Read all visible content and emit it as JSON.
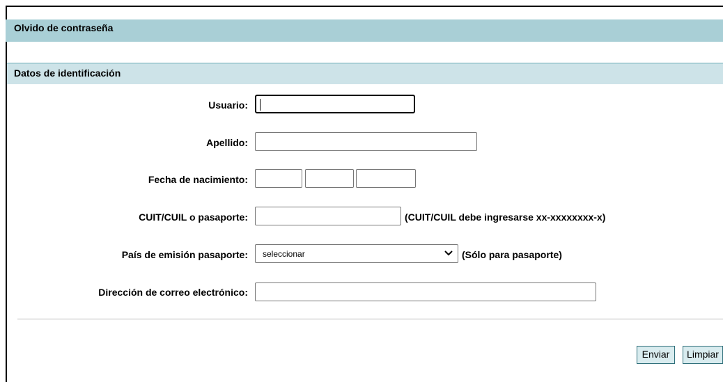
{
  "page": {
    "title": "Olvido de contraseña",
    "section_title": "Datos de identificación"
  },
  "form": {
    "usuario_label": "Usuario:",
    "usuario_value": "",
    "apellido_label": "Apellido:",
    "apellido_value": "",
    "fecha_label": "Fecha de nacimiento:",
    "fecha_day": "",
    "fecha_month": "",
    "fecha_year": "",
    "cuit_label": "CUIT/CUIL o pasaporte:",
    "cuit_value": "",
    "cuit_hint": "(CUIT/CUIL debe ingresarse xx-xxxxxxxx-x)",
    "pais_label": "País de emisión pasaporte:",
    "pais_selected": "seleccionar",
    "pais_hint": "(Sólo para pasaporte)",
    "email_label": "Dirección de correo electrónico:",
    "email_value": ""
  },
  "actions": {
    "enviar": "Enviar",
    "limpiar": "Limpiar"
  },
  "icons": {
    "select_arrow": "chevron-down-icon"
  }
}
